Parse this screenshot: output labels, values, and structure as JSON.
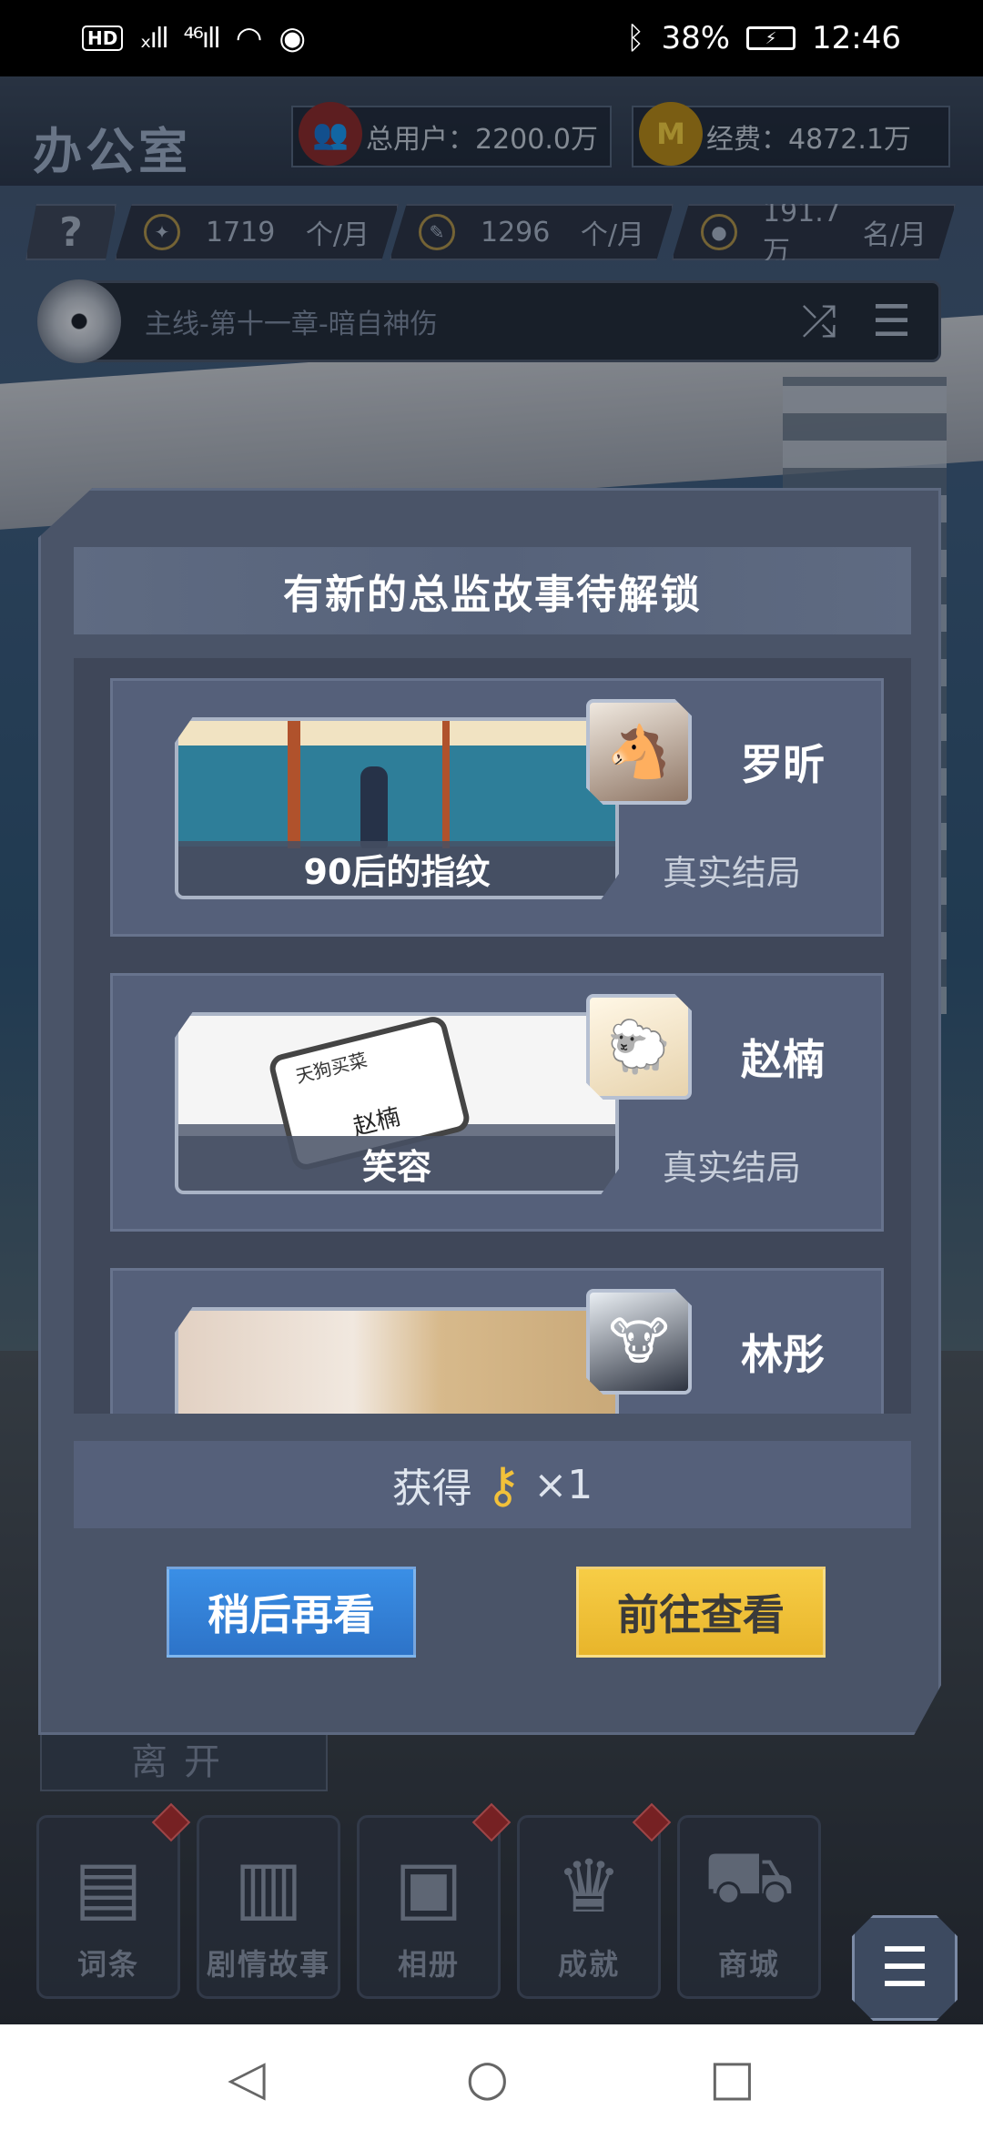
{
  "status_bar": {
    "hd": "HD",
    "sig1": "ₓıll",
    "sig2": "⁴⁶ıll",
    "battery_pct": "38%",
    "time": "12:46"
  },
  "header": {
    "title": "办公室",
    "total_users": "总用户：2200.0万",
    "funds": "经费：4872.1万"
  },
  "resources": {
    "help": "?",
    "items": [
      {
        "value": "1719",
        "unit": "个/月",
        "icon": "lightbulb-icon"
      },
      {
        "value": "1296",
        "unit": "个/月",
        "icon": "wrench-icon"
      },
      {
        "value": "191.7万",
        "unit": "名/月",
        "icon": "person-icon"
      }
    ]
  },
  "mission": {
    "text": "主线-第十一章-暗自神伤"
  },
  "modal": {
    "title": "有新的总监故事待解锁",
    "stories": [
      {
        "caption": "90后的指纹",
        "name": "罗昕",
        "ending": "真实结局"
      },
      {
        "caption": "笑容",
        "name": "赵楠",
        "ending": "真实结局",
        "badge_top": "天狗买菜",
        "badge_name": "赵楠"
      },
      {
        "caption": "",
        "name": "林彤",
        "ending": ""
      }
    ],
    "reward_label": "获得",
    "reward_count": "×1",
    "later_button": "稍后再看",
    "go_button": "前往查看"
  },
  "leave_button": "离开",
  "bottom_nav": [
    {
      "label": "词条",
      "icon": "notebook-icon",
      "badge": true
    },
    {
      "label": "剧情故事",
      "icon": "book-icon",
      "badge": false
    },
    {
      "label": "相册",
      "icon": "photo-icon",
      "badge": true
    },
    {
      "label": "成就",
      "icon": "trophy-icon",
      "badge": true
    },
    {
      "label": "商城",
      "icon": "cart-icon",
      "badge": false
    }
  ]
}
